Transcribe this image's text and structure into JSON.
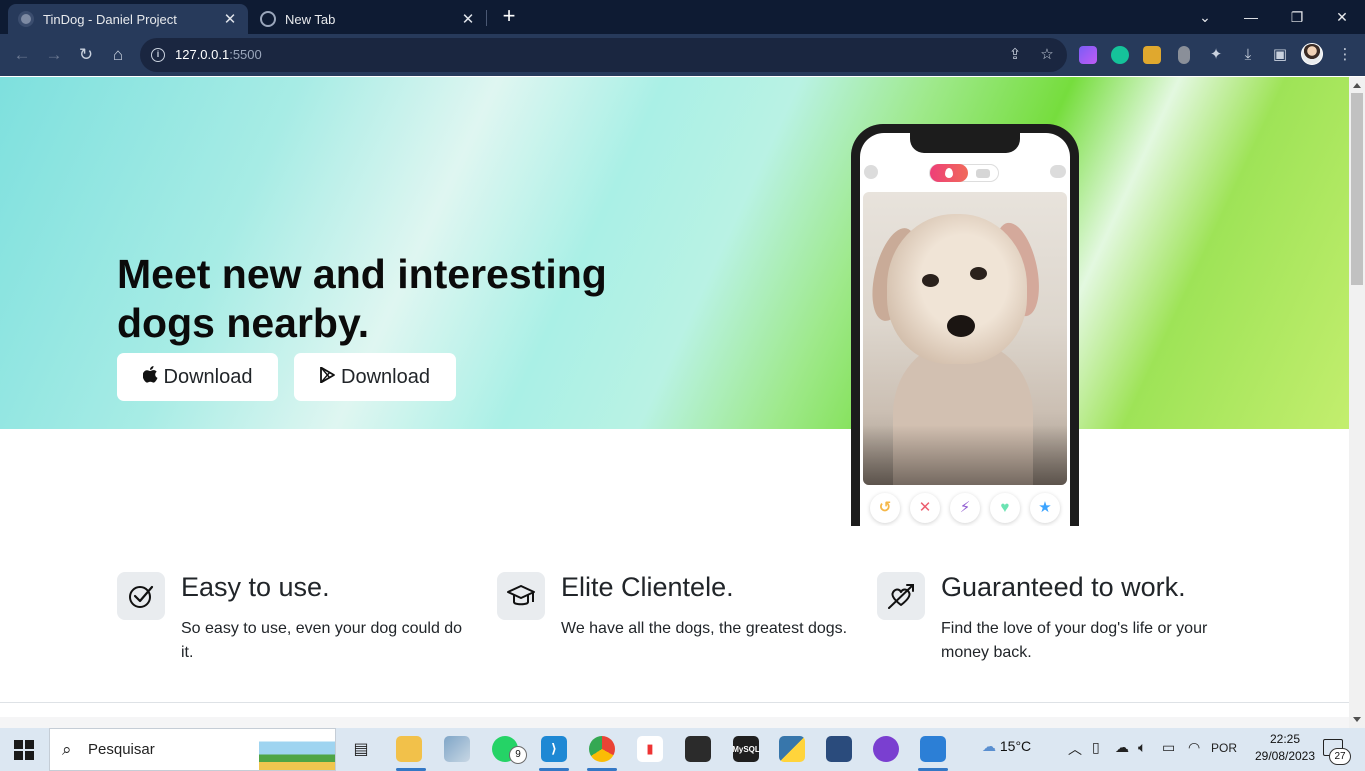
{
  "browser": {
    "tabs": [
      {
        "label": "TinDog - Daniel Project",
        "active": true
      },
      {
        "label": "New Tab",
        "active": false
      }
    ],
    "new_tab_icon": "plus-icon",
    "window_controls": [
      "chevron-down-icon",
      "minimize-icon",
      "restore-icon",
      "close-icon"
    ],
    "address": {
      "host": "127.0.0.1",
      "port": ":5500"
    },
    "nav_icons": [
      "back-icon",
      "forward-icon",
      "reload-icon",
      "home-icon"
    ],
    "toolbar_icons": [
      "share-icon",
      "star-icon",
      "extensions-icon",
      "download-icon",
      "side-panel-icon",
      "menu-icon"
    ]
  },
  "hero": {
    "title": "Meet new and interesting dogs nearby.",
    "buttons": [
      {
        "label": "Download",
        "icon": "apple-icon"
      },
      {
        "label": "Download",
        "icon": "google-play-icon"
      }
    ]
  },
  "phone_app": {
    "actions": [
      {
        "icon": "rewind-icon",
        "glyph": "↺",
        "color": "#f5b748"
      },
      {
        "icon": "nope-icon",
        "glyph": "✕",
        "color": "#ec5e6f"
      },
      {
        "icon": "boost-icon",
        "glyph": "⚡",
        "color": "#915dd1"
      },
      {
        "icon": "like-icon",
        "glyph": "♥",
        "color": "#6be3b2"
      },
      {
        "icon": "super-like-icon",
        "glyph": "★",
        "color": "#3ca4ff"
      }
    ]
  },
  "features": [
    {
      "icon": "check-circle-icon",
      "title": "Easy to use.",
      "text": "So easy to use, even your dog could do it."
    },
    {
      "icon": "graduation-cap-icon",
      "title": "Elite Clientele.",
      "text": "We have all the dogs, the greatest dogs."
    },
    {
      "icon": "heart-arrow-icon",
      "title": "Guaranteed to work.",
      "text": "Find the love of your dog's life or your money back."
    }
  ],
  "taskbar": {
    "search_placeholder": "Pesquisar",
    "whatsapp_badge": "9",
    "weather": "15°C",
    "language": "POR",
    "time": "22:25",
    "date": "29/08/2023",
    "notifications": "27"
  }
}
